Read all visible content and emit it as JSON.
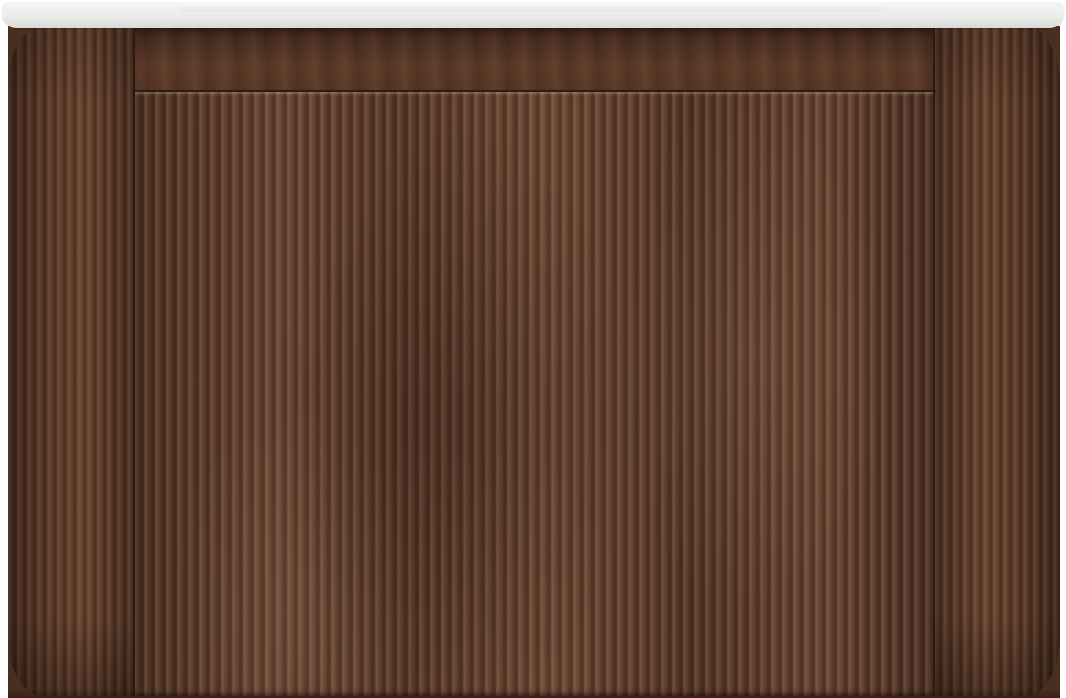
{
  "product": {
    "subject": "fluted-walnut-bathroom-vanity",
    "colors": {
      "wood_dark": "#4a2e20",
      "wood_mid": "#6a4331",
      "countertop": "#ececea"
    }
  }
}
